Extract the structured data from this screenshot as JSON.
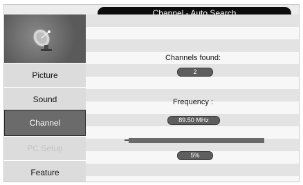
{
  "header": {
    "title": "Channel - Auto Search"
  },
  "sidebar": {
    "logo_icon": "satellite-dish-icon",
    "items": [
      {
        "label": "Picture",
        "state": "normal"
      },
      {
        "label": "Sound",
        "state": "normal"
      },
      {
        "label": "Channel",
        "state": "active"
      },
      {
        "label": "PC Setup",
        "state": "disabled"
      },
      {
        "label": "Feature",
        "state": "normal"
      }
    ]
  },
  "search": {
    "channels_label": "Channels found:",
    "channels_value": "2",
    "frequency_label": "Frequency :",
    "frequency_value": "89.50 MHz",
    "progress_percent": 5,
    "progress_text": "5%"
  },
  "colors": {
    "active_item": "#6b6b6b",
    "title_bar": "#0d0d0d",
    "pill": "#5e5e5e"
  }
}
